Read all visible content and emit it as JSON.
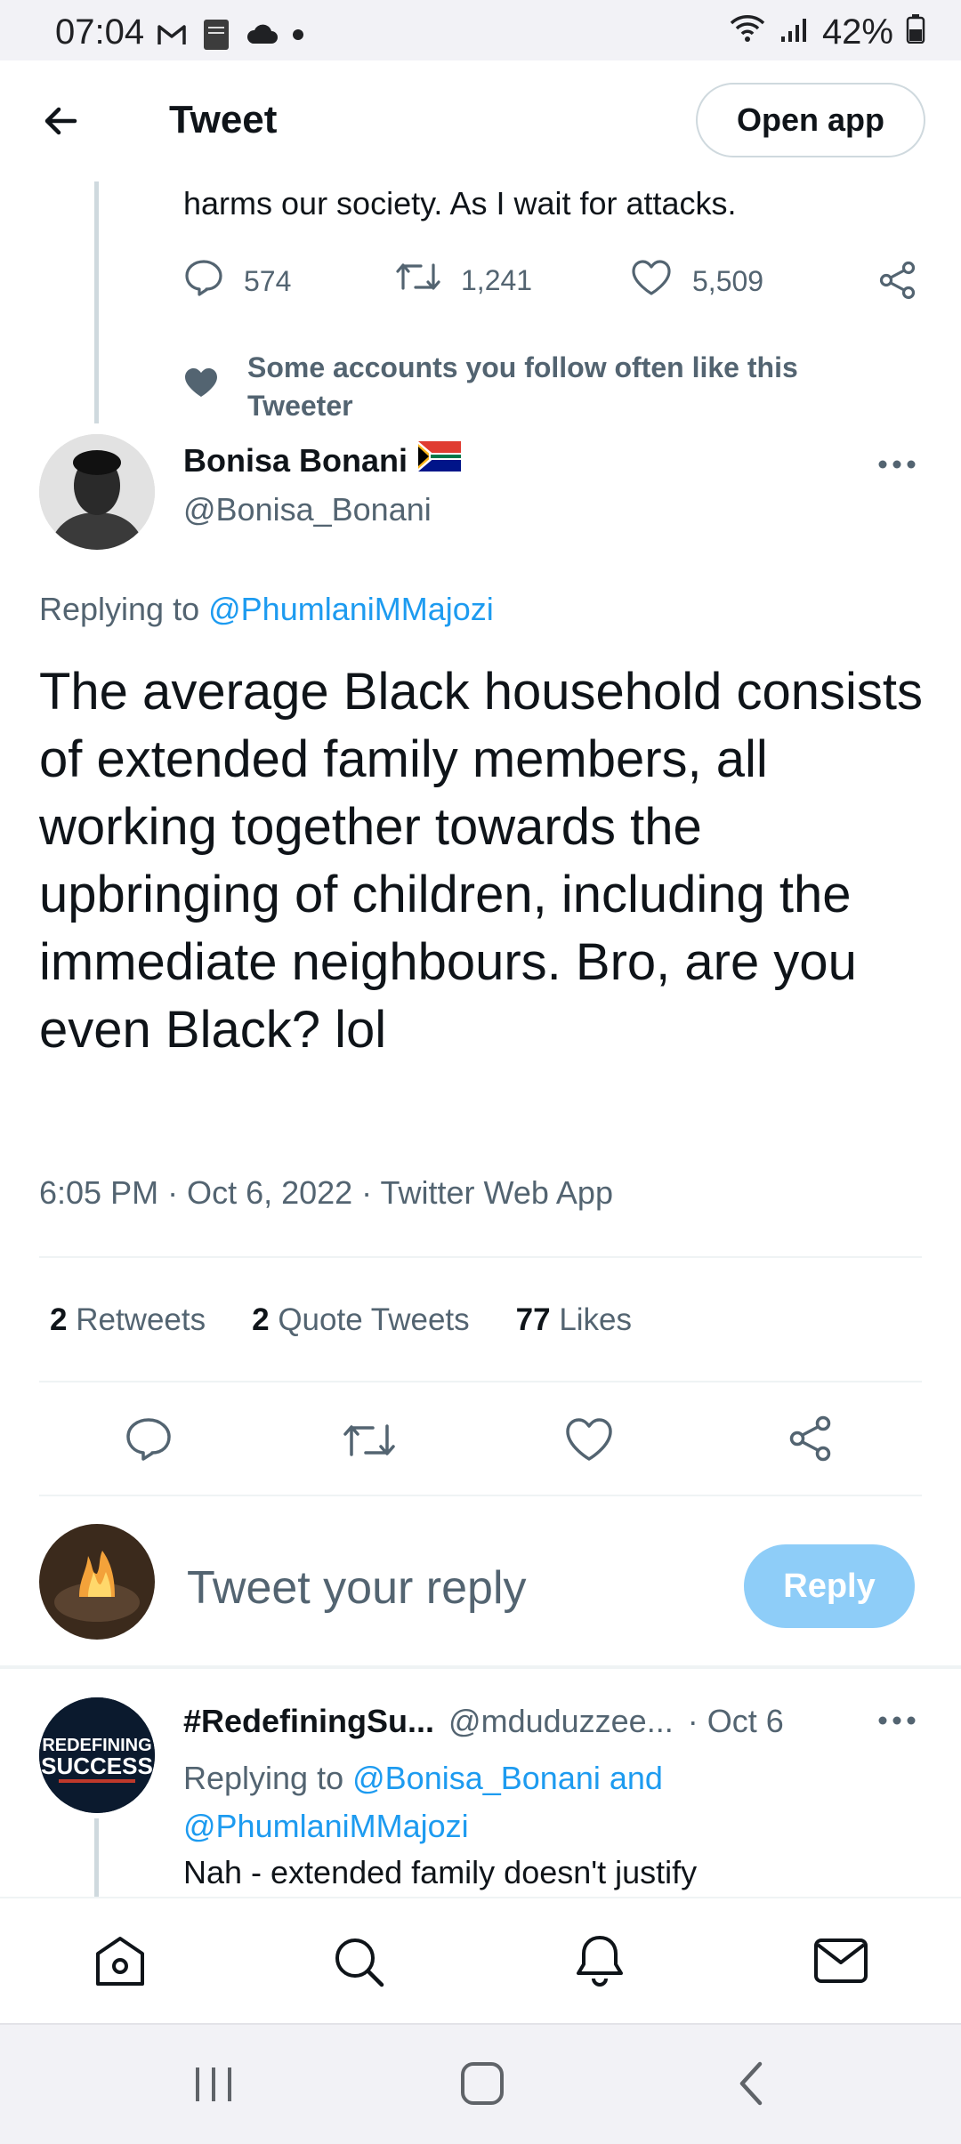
{
  "status_bar": {
    "time": "07:04",
    "battery": "42%",
    "left_icons": [
      "gmail-icon",
      "bible-icon",
      "cloud-icon",
      "dot-icon"
    ],
    "right_icons": [
      "wifi-icon",
      "signal-icon",
      "battery-icon"
    ]
  },
  "header": {
    "title": "Tweet",
    "open_app_label": "Open app"
  },
  "parent_tweet": {
    "text_tail": "harms our society. As I wait for attacks.",
    "replies": "574",
    "retweets": "1,241",
    "likes": "5,509"
  },
  "social_context": {
    "text": "Some accounts you follow often like this Tweeter"
  },
  "main_tweet": {
    "display_name": "Bonisa Bonani",
    "flag": "south-africa-flag",
    "handle": "@Bonisa_Bonani",
    "replying_prefix": "Replying to",
    "replying_to": "@PhumlaniMMajozi",
    "body": "The average Black household consists of extended family members, all working together towards the upbringing of children, including the immediate neighbours. Bro, are you even Black? lol",
    "timestamp": "6:05 PM · Oct 6, 2022 · Twitter Web App",
    "stats": {
      "retweets_count": "2",
      "retweets_label": "Retweets",
      "quotes_count": "2",
      "quotes_label": "Quote Tweets",
      "likes_count": "77",
      "likes_label": "Likes"
    }
  },
  "composer": {
    "placeholder": "Tweet your reply",
    "reply_label": "Reply"
  },
  "reply": {
    "display_name": "#RedefiningSu...",
    "handle": "@mduduzzee...",
    "sep_date": "· Oct 6",
    "replying_prefix": "Replying to",
    "replying_to_line1": "@Bonisa_Bonani and",
    "replying_to_line2": "@PhumlaniMMajozi",
    "text": "Nah - extended family doesn't justify",
    "avatar_text_line1": "REDEFINING",
    "avatar_text_line2": "SUCCESS"
  },
  "colors": {
    "accent": "#1d9bf0",
    "reply_button_disabled": "#8ecdf8",
    "muted": "#536471"
  }
}
